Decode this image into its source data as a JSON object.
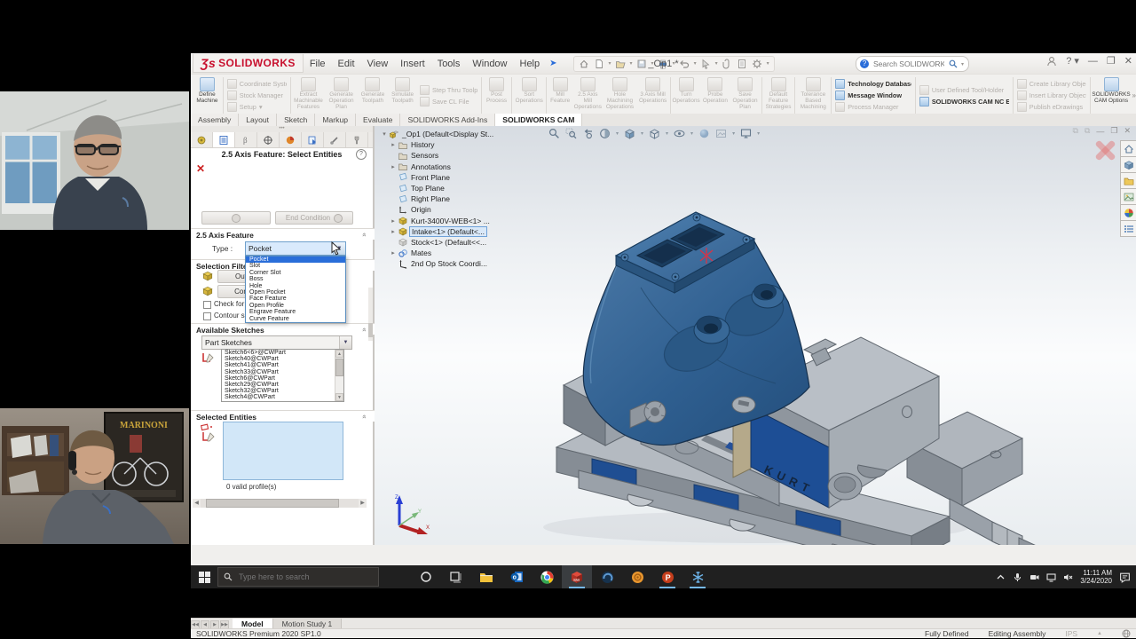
{
  "webcams": {
    "poster_title": "MARINONI"
  },
  "titlebar": {
    "logo_text": "SOLIDWORKS",
    "menus": [
      "File",
      "Edit",
      "View",
      "Insert",
      "Tools",
      "Window",
      "Help"
    ],
    "doc_title": "_Op1 *",
    "search_placeholder": "Search SOLIDWORKS Help",
    "help_label": "?"
  },
  "ribbon": {
    "btn_define_machine": "Define Machine",
    "btn_coordinate_system": "Coordinate System",
    "btn_stock_manager": "Stock Manager",
    "btn_setup": "Setup",
    "btn_extract": "Extract Machinable Features",
    "btn_gen_plan": "Generate Operation Plan",
    "btn_gen_toolpath": "Generate Toolpath",
    "btn_simulate": "Simulate Toolpath",
    "btn_step_thru": "Step Thru Toolpath",
    "btn_save_cl": "Save CL File",
    "btn_post_process": "Post Process",
    "btn_sort_ops": "Sort Operations",
    "btn_mill_feature": "Mill Feature",
    "btn_25axis": "2.5 Axis Mill Operations",
    "btn_hole": "Hole Machining Operations",
    "btn_3axis": "3 Axis Mill Operations",
    "btn_turn": "Turn Operations",
    "btn_probe": "Probe Operation",
    "btn_save_plan": "Save Operation Plan",
    "btn_default_strategies": "Default Feature Strategies",
    "btn_tbm": "Tolerance Based Machining",
    "btn_tech_db": "Technology Database",
    "btn_msg_window": "Message Window",
    "btn_process_mgr": "Process Manager",
    "btn_udt": "User Defined Tool/Holder",
    "btn_nc_editor": "SOLIDWORKS CAM NC Editor",
    "btn_create_lib": "Create Library Object",
    "btn_insert_lib": "Insert Library Object",
    "btn_publish": "Publish eDrawings",
    "btn_cam_options": "SOLIDWORKS CAM Options",
    "overflow": "»"
  },
  "tabs": {
    "t0": "Assembly",
    "t1": "Layout",
    "t2": "Sketch",
    "t3": "Markup",
    "t4": "Evaluate",
    "t5": "SOLIDWORKS Add-Ins",
    "t6": "SOLIDWORKS CAM"
  },
  "panel": {
    "title": "2.5 Axis Feature: Select Entities",
    "help": "?",
    "end_condition": "End Condition",
    "feature_header": "2.5 Axis Feature",
    "type_label": "Type :",
    "type_value": "Pocket",
    "options": [
      "Pocket",
      "Slot",
      "Corner Slot",
      "Boss",
      "Hole",
      "Open Pocket",
      "Face Feature",
      "Open Profile",
      "Engrave Feature",
      "Curve Feature"
    ],
    "filter_header": "Selection Filter",
    "filter_btn1": "Outer l",
    "filter_btn2": "Conver",
    "filter_check1": "Check for ta",
    "filter_check2": "Contour sel",
    "sketches_header": "Available Sketches",
    "sketches_dropdown": "Part Sketches",
    "sketches": [
      "Sketch6<6>@CWPart",
      "Sketch40@CWPart",
      "Sketch41@CWPart",
      "Sketch33@CWPart",
      "Sketch6@CWPart",
      "Sketch29@CWPart",
      "Sketch32@CWPart",
      "Sketch4@CWPart"
    ],
    "selected_header": "Selected Entities",
    "selected_status": "0 valid profile(s)"
  },
  "tree": {
    "items": [
      "_Op1 (Default<Display St...",
      "History",
      "Sensors",
      "Annotations",
      "Front Plane",
      "Top Plane",
      "Right Plane",
      "Origin",
      "Kurt-3400V-WEB<1> ...",
      "Intake<1> (Default<...",
      "Stock<1> (Default<<...",
      "Mates",
      "2nd Op Stock Coordi..."
    ]
  },
  "viewport": {
    "vise_brand": "KURT",
    "triad": {
      "x": "X",
      "y": "Y",
      "z": "Z"
    }
  },
  "bottom_bar": {
    "tab_model": "Model",
    "tab_motion": "Motion Study 1",
    "status_left": "SOLIDWORKS Premium 2020 SP1.0",
    "status_defined": "Fully Defined",
    "status_editing": "Editing Assembly",
    "status_units": "IPS"
  },
  "taskbar": {
    "search_placeholder": "Type here to search",
    "time": "11:11 AM",
    "date": "3/24/2020"
  }
}
